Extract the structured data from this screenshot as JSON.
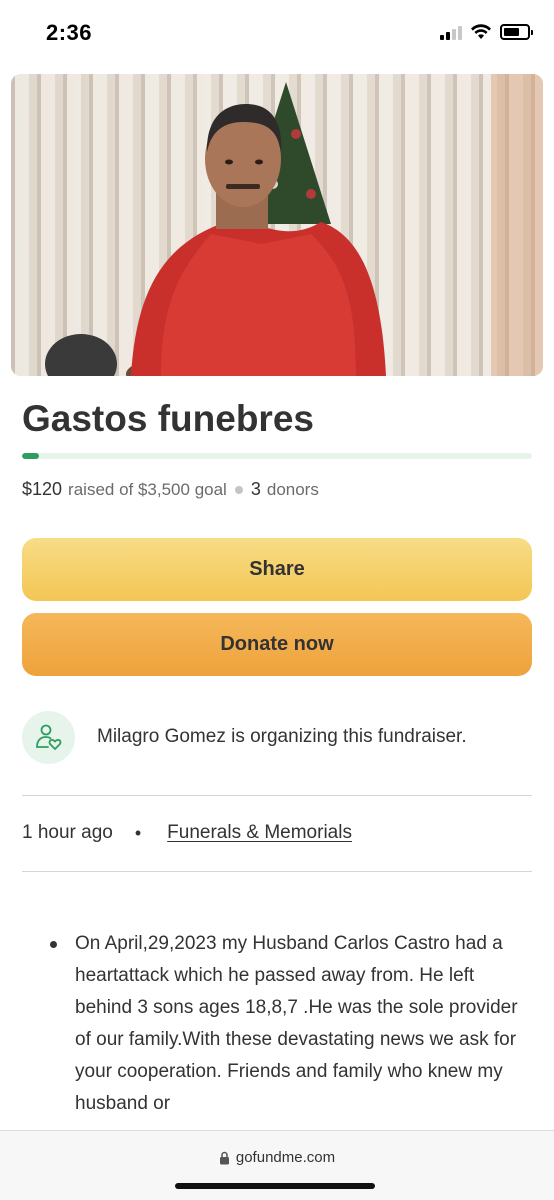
{
  "status_bar": {
    "time": "2:36",
    "icons": [
      "cellular-signal-icon",
      "wifi-icon",
      "battery-icon"
    ]
  },
  "hero": {
    "image": "photo of man in red tank top in front of vertical blinds and christmas tree"
  },
  "fundraiser": {
    "title": "Gastos funebres",
    "raised_amount": "$120",
    "raised_text": "raised of $3,500 goal",
    "donor_count": "3",
    "donors_label": "donors",
    "progress_fraction": 0.034
  },
  "actions": {
    "share_label": "Share",
    "donate_label": "Donate now"
  },
  "organizer": {
    "text": "Milagro Gomez is organizing this fundraiser.",
    "icon": "organizer-heart-person-icon"
  },
  "meta": {
    "time_ago": "1 hour ago",
    "category": "Funerals & Memorials"
  },
  "story": {
    "text": "On April,29,2023 my Husband Carlos Castro had a heartattack which he passed away from. He left behind 3 sons ages 18,8,7 .He was the sole provider of our family.With these devastating news we ask for your cooperation. Friends and family who knew my husband or"
  },
  "browser": {
    "url": "gofundme.com"
  },
  "colors": {
    "progress": "#2f9d5f",
    "share_button": "#f3c654",
    "donate_button": "#eea23c",
    "text": "#333333"
  }
}
